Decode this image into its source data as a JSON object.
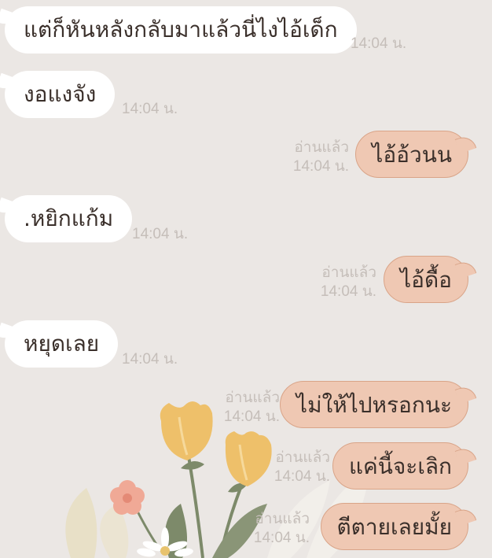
{
  "messages": [
    {
      "side": "in",
      "text": "แต่ก็หันหลังกลับมาแล้วนี่ไงไอ้เด็ก",
      "time": "14:04 น."
    },
    {
      "side": "in",
      "text": "งอแงจัง",
      "time": "14:04 น."
    },
    {
      "side": "out",
      "text": "ไอ้อ้วนน",
      "read": "อ่านแล้ว",
      "time": "14:04 น."
    },
    {
      "side": "in",
      "text": ".หยิกแก้ม",
      "time": "14:04 น."
    },
    {
      "side": "out",
      "text": "ไอ้ดื้อ",
      "read": "อ่านแล้ว",
      "time": "14:04 น."
    },
    {
      "side": "in",
      "text": "หยุดเลย",
      "time": "14:04 น."
    },
    {
      "side": "out",
      "text": "ไม่ให้ไปหรอกนะ",
      "read": "อ่านแล้ว",
      "time": "14:04 น."
    },
    {
      "side": "out",
      "text": "แค่นี้จะเลิก",
      "read": "อ่านแล้ว",
      "time": "14:04 น."
    },
    {
      "side": "out",
      "text": "ตีตายเลยมั้ย",
      "read": "อ่านแล้ว",
      "time": "14:04 น."
    }
  ],
  "colors": {
    "background": "#ebe7e4",
    "incoming_bubble": "#ffffff",
    "outgoing_bubble": "#efc8b3",
    "meta_text": "#c5beb9"
  },
  "icons": [
    "flower-bouquet-illustration"
  ]
}
